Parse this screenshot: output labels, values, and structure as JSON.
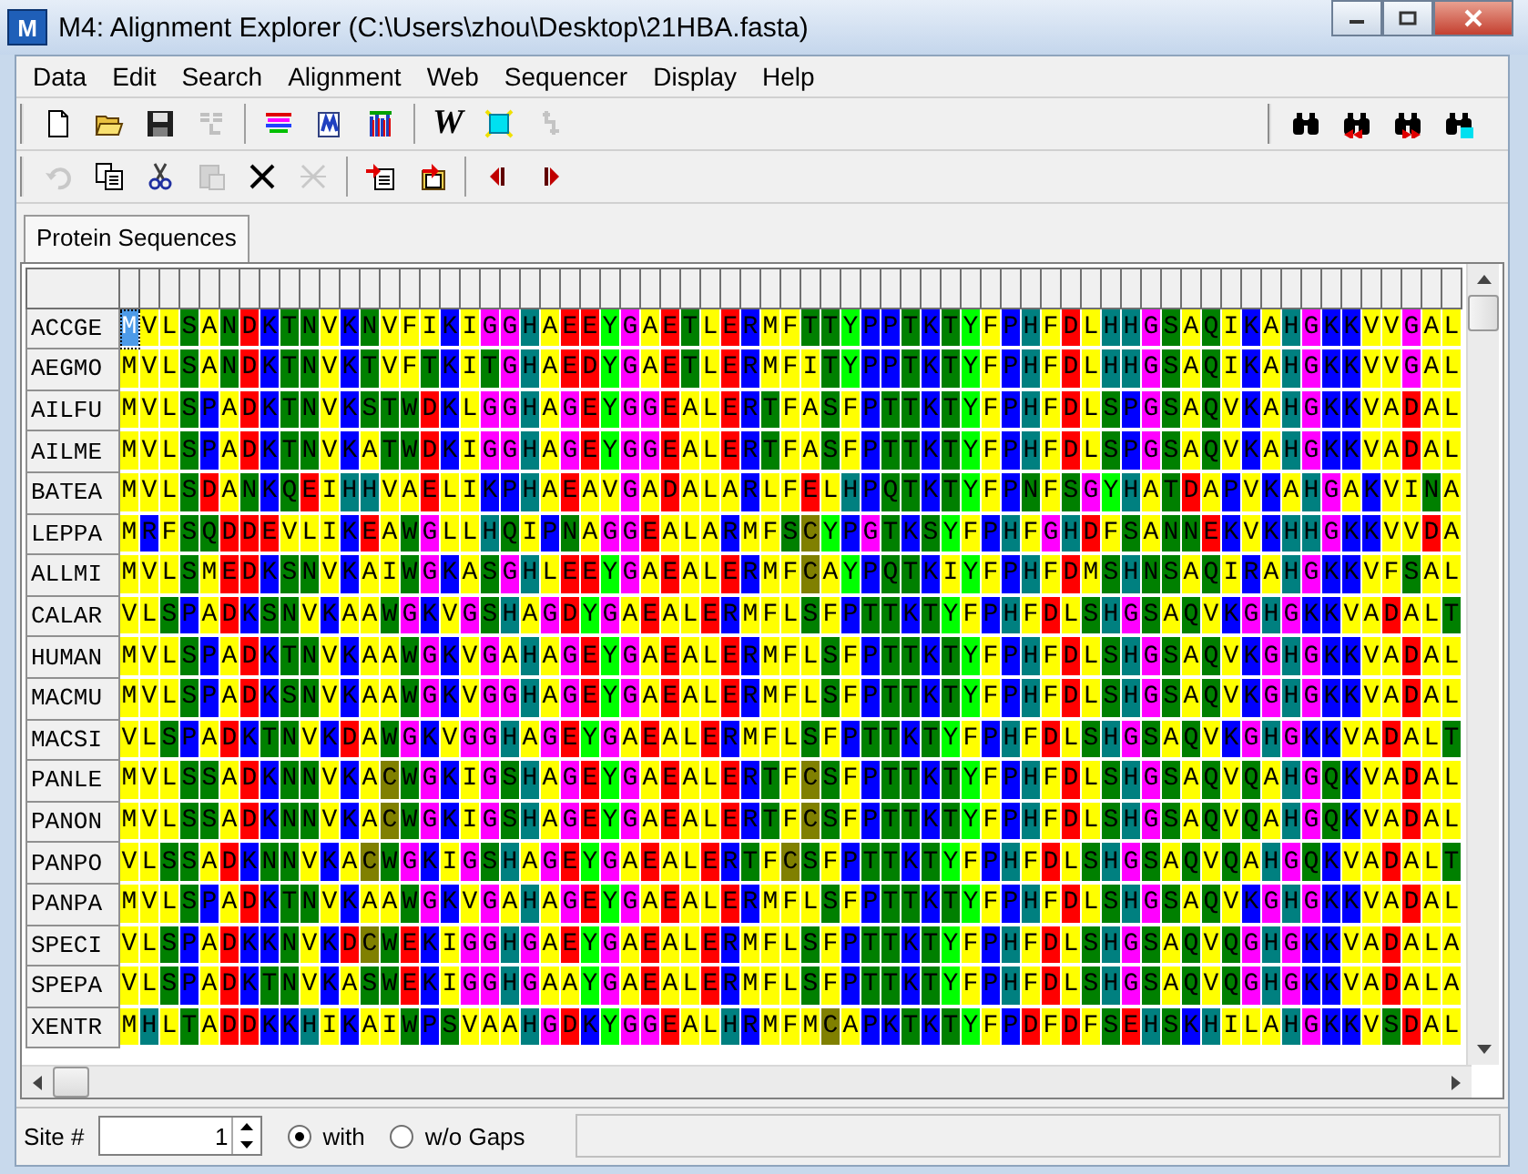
{
  "window": {
    "icon_text": "M",
    "title": "M4: Alignment Explorer (C:\\Users\\zhou\\Desktop\\21HBA.fasta)"
  },
  "menu": [
    "Data",
    "Edit",
    "Search",
    "Alignment",
    "Web",
    "Sequencer",
    "Display",
    "Help"
  ],
  "toolbar_main": [
    {
      "kind": "new",
      "disabled": false
    },
    {
      "kind": "open",
      "disabled": false
    },
    {
      "kind": "save",
      "disabled": false
    },
    {
      "kind": "translate",
      "disabled": true
    },
    {
      "kind": "sep"
    },
    {
      "kind": "align",
      "disabled": false
    },
    {
      "kind": "doc",
      "disabled": false
    },
    {
      "kind": "bars",
      "disabled": false
    },
    {
      "kind": "sep"
    },
    {
      "kind": "text",
      "label": "W",
      "disabled": false
    },
    {
      "kind": "mark",
      "disabled": false
    },
    {
      "kind": "gap",
      "disabled": true
    }
  ],
  "toolbar_find": [
    {
      "kind": "find",
      "disabled": false
    },
    {
      "kind": "find_prev",
      "disabled": false
    },
    {
      "kind": "find_next",
      "disabled": false
    },
    {
      "kind": "find_mark",
      "disabled": false
    }
  ],
  "toolbar_edit": [
    {
      "kind": "undo",
      "disabled": true
    },
    {
      "kind": "copy",
      "disabled": false
    },
    {
      "kind": "cut",
      "disabled": false
    },
    {
      "kind": "paste",
      "disabled": true
    },
    {
      "kind": "delete",
      "disabled": false
    },
    {
      "kind": "delete_gap",
      "disabled": true
    },
    {
      "kind": "sep"
    },
    {
      "kind": "import",
      "disabled": false
    },
    {
      "kind": "import_folder",
      "disabled": false
    },
    {
      "kind": "sep"
    },
    {
      "kind": "prev",
      "disabled": false
    },
    {
      "kind": "next",
      "disabled": false
    }
  ],
  "tabs": [
    {
      "label": "Protein Sequences",
      "selected": true
    }
  ],
  "residue_colors": {
    "A": {
      "color": "#ffff00"
    },
    "V": {
      "color": "#ffff00"
    },
    "L": {
      "color": "#ffff00"
    },
    "I": {
      "color": "#ffff00"
    },
    "M": {
      "color": "#ffff00"
    },
    "F": {
      "color": "#ffff00"
    },
    "Y": {
      "color": "#00ff00"
    },
    "W": {
      "color": "#008000"
    },
    "S": {
      "color": "#008000"
    },
    "T": {
      "color": "#008000"
    },
    "N": {
      "color": "#008000"
    },
    "Q": {
      "color": "#008000"
    },
    "C": {
      "color": "#808000"
    },
    "G": {
      "color": "#ff00ff"
    },
    "P": {
      "color": "#0000ff"
    },
    "K": {
      "color": "#0000ff"
    },
    "R": {
      "color": "#0000ff"
    },
    "H": {
      "color": "#008080"
    },
    "D": {
      "color": "#ff0000"
    },
    "E": {
      "color": "#ff0000"
    }
  },
  "sequences": [
    {
      "name": "ACCGE",
      "selected": true,
      "residues": "MVLSANDKTNVKNVFIKIGGHAEEYGAETLERMFTTYPPTKTYFPHFDLHHGSAQIKAHGKKVVGAL"
    },
    {
      "name": "AEGMO",
      "selected": false,
      "residues": "MVLSANDKTNVKTVFTKITGHAEDYGAETLERMFITYPPTKTYFPHFDLHHGSAQIKAHGKKVVGAL"
    },
    {
      "name": "AILFU",
      "selected": false,
      "residues": "MVLSPADKTNVKSTWDKLGGHAGEYGGEALERTFASFPTTKTYFPHFDLSPGSAQVKAHGKKVADAL"
    },
    {
      "name": "AILME",
      "selected": false,
      "residues": "MVLSPADKTNVKATWDKIGGHAGEYGGEALERTFASFPTTKTYFPHFDLSPGSAQVKAHGKKVADAL"
    },
    {
      "name": "BATEA",
      "selected": false,
      "residues": "MVLSDANKQEIHHVAELIKPHAEAVGADALARLFELHPQTKTYFPNFSGYHATDAPVKAHGAKVINA"
    },
    {
      "name": "LEPPA",
      "selected": false,
      "residues": "MRFSQDDEVLIKEAWGLLHQIPNAGGEALARMFSCYPGTKSYFPHFGHDFSANNEKVKHHGKKVVDA"
    },
    {
      "name": "ALLMI",
      "selected": false,
      "residues": "MVLSMEDKSNVKAIWGKASGHLEEYGAEALERMFCAYPQTKIYFPHFDMSHNSAQIRAHGKKVFSAL"
    },
    {
      "name": "CALAR",
      "selected": false,
      "residues": "VLSPADKSNVKAAWGKVGSHAGDYGAEALERMFLSFPTTKTYFPHFDLSHGSAQVKGHGKKVADALT"
    },
    {
      "name": "HUMAN",
      "selected": false,
      "residues": "MVLSPADKTNVKAAWGKVGAHAGEYGAEALERMFLSFPTTKTYFPHFDLSHGSAQVKGHGKKVADAL"
    },
    {
      "name": "MACMU",
      "selected": false,
      "residues": "MVLSPADKSNVKAAWGKVGGHAGEYGAEALERMFLSFPTTKTYFPHFDLSHGSAQVKGHGKKVADAL"
    },
    {
      "name": "MACSI",
      "selected": false,
      "residues": "VLSPADKTNVKDAWGKVGGHAGEYGAEALERMFLSFPTTKTYFPHFDLSHGSAQVKGHGKKVADALT"
    },
    {
      "name": "PANLE",
      "selected": false,
      "residues": "MVLSSADKNNVKACWGKIGSHAGEYGAEALERTFCSFPTTKTYFPHFDLSHGSAQVQAHGQKVADAL"
    },
    {
      "name": "PANON",
      "selected": false,
      "residues": "MVLSSADKNNVKACWGKIGSHAGEYGAEALERTFCSFPTTKTYFPHFDLSHGSAQVQAHGQKVADAL"
    },
    {
      "name": "PANPO",
      "selected": false,
      "residues": "VLSSADKNNVKACWGKIGSHAGEYGAEALERTFCSFPTTKTYFPHFDLSHGSAQVQAHGQKVADALT"
    },
    {
      "name": "PANPA",
      "selected": false,
      "residues": "MVLSPADKTNVKAAWGKVGAHAGEYGAEALERMFLSFPTTKTYFPHFDLSHGSAQVKGHGKKVADAL"
    },
    {
      "name": "SPECI",
      "selected": false,
      "residues": "VLSPADKKNVKDCWEKIGGHGAEYGAEALERMFLSFPTTKTYFPHFDLSHGSAQVQGHGKKVADALA"
    },
    {
      "name": "SPEPA",
      "selected": false,
      "residues": "VLSPADKTNVKASWEKIGGHGAAYGAEALERMFLSFPTTKTYFPHFDLSHGSAQVQGHGKKVADALA"
    },
    {
      "name": "XENTR",
      "selected": false,
      "residues": "MHLTADDKKHIKAIWPSVAAHGDKYGGEALHRMFMCAPKTKTYFPDFDFSEHSKHILAHGKKVSDAL"
    }
  ],
  "status_bar": {
    "site_label": "Site #",
    "site_value": "1",
    "gap_options": [
      {
        "label": "with",
        "selected": true
      },
      {
        "label": "w/o Gaps",
        "selected": false
      }
    ]
  }
}
